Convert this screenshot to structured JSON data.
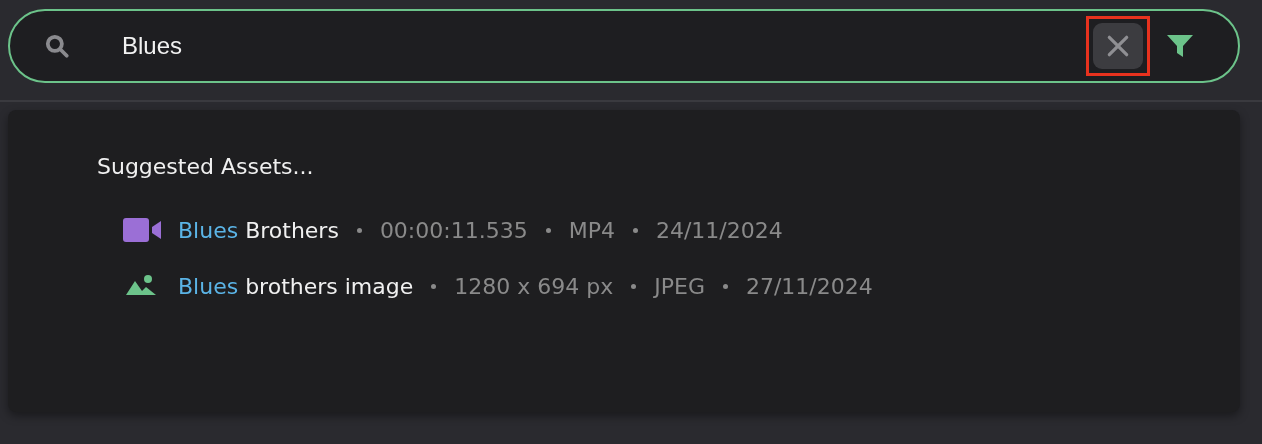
{
  "search": {
    "value": "Blues"
  },
  "suggestions": {
    "title": "Suggested Assets...",
    "items": [
      {
        "kind": "video",
        "match": "Blues",
        "rest": " Brothers",
        "details": [
          "00:00:11.535",
          "MP4",
          "24/11/2024"
        ]
      },
      {
        "kind": "image",
        "match": "Blues",
        "rest": " brothers image",
        "details": [
          "1280 x 694 px",
          "JPEG",
          "27/11/2024"
        ]
      }
    ]
  }
}
